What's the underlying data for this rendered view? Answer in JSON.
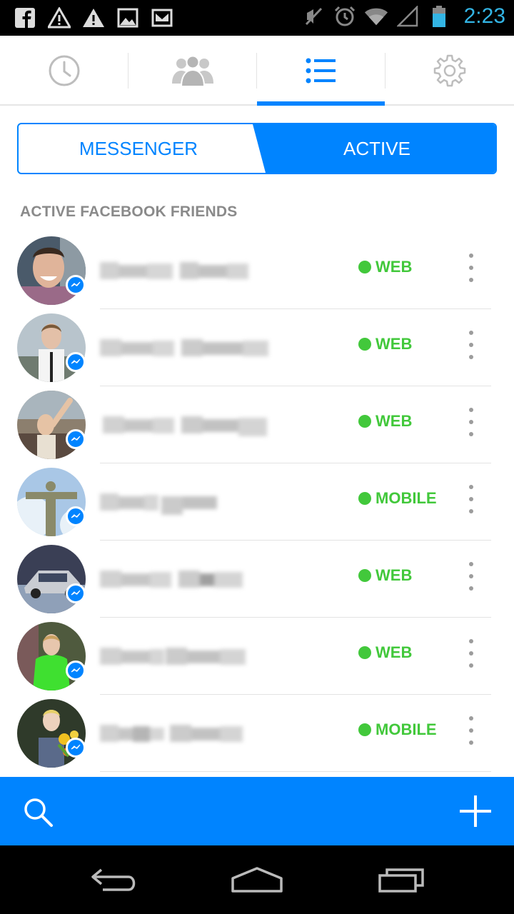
{
  "status_bar": {
    "time": "2:23",
    "left_icons": [
      "facebook-icon",
      "warning-icon",
      "warning-icon",
      "image-icon",
      "mail-icon"
    ],
    "right_icons": [
      "mute-icon",
      "alarm-icon",
      "wifi-icon",
      "signal-icon",
      "battery-icon"
    ]
  },
  "top_tabs": [
    {
      "icon": "clock-icon",
      "selected": false
    },
    {
      "icon": "groups-icon",
      "selected": false
    },
    {
      "icon": "list-icon",
      "selected": true
    },
    {
      "icon": "gear-icon",
      "selected": false
    }
  ],
  "segment": {
    "left_label": "MESSENGER",
    "right_label": "ACTIVE",
    "selected": "ACTIVE"
  },
  "section_header": "ACTIVE FACEBOOK FRIENDS",
  "friends": [
    {
      "presence": "WEB"
    },
    {
      "presence": "WEB"
    },
    {
      "presence": "WEB"
    },
    {
      "presence": "MOBILE"
    },
    {
      "presence": "WEB"
    },
    {
      "presence": "WEB"
    },
    {
      "presence": "MOBILE"
    }
  ],
  "bottom_bar": {
    "left_icon": "search-icon",
    "right_icon": "plus-icon"
  },
  "nav_bar": [
    "back-icon",
    "home-icon",
    "recents-icon"
  ],
  "colors": {
    "accent": "#0084ff",
    "presence": "#42c83b",
    "status_time": "#33b5e5"
  }
}
